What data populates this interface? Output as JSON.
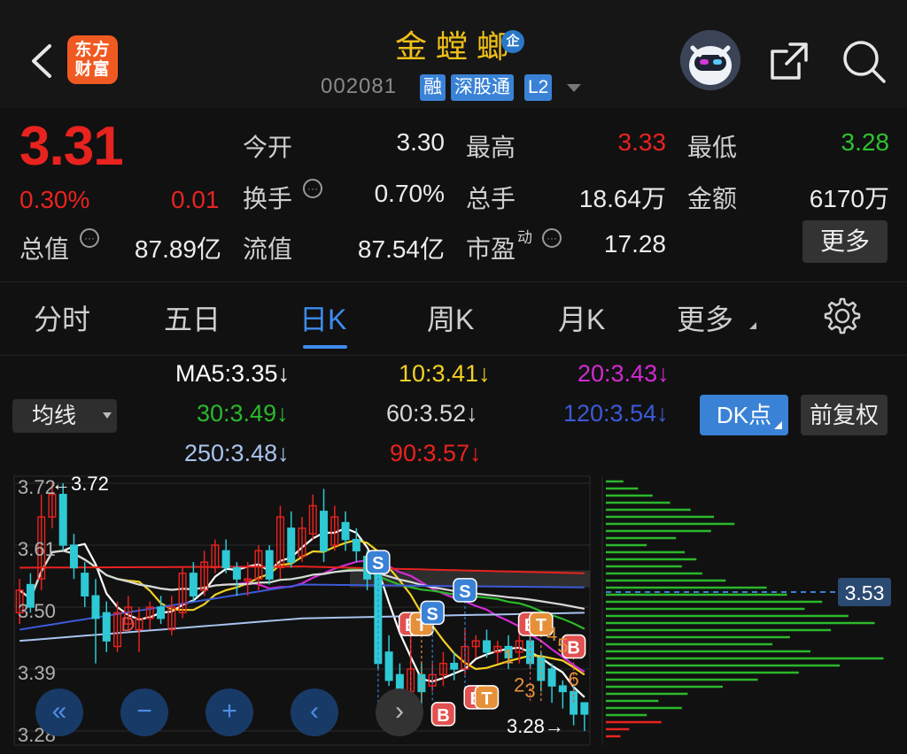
{
  "header": {
    "back_icon": "chevron-left-icon",
    "logo_line1": "东方",
    "logo_line2": "财富",
    "stock_name": "金螳螂",
    "badge": "企",
    "code": "002081",
    "tags": [
      "融",
      "深股通",
      "L2"
    ],
    "share_icon": "share-icon",
    "search_icon": "search-icon"
  },
  "quote": {
    "price": "3.31",
    "change_pct": "0.30%",
    "change": "0.01",
    "stats": [
      {
        "label": "今开",
        "value": "3.30",
        "color": "#ececec"
      },
      {
        "label": "最高",
        "value": "3.33",
        "color": "#e8231f"
      },
      {
        "label": "最低",
        "value": "3.28",
        "color": "#2fc22f"
      },
      {
        "label": "换手",
        "value": "0.70%",
        "color": "#ececec"
      },
      {
        "label": "总手",
        "value": "18.64万",
        "color": "#ececec"
      },
      {
        "label": "金额",
        "value": "6170万",
        "color": "#ececec"
      },
      {
        "label": "总值",
        "value": "87.89亿",
        "color": "#ececec"
      },
      {
        "label": "流值",
        "value": "87.54亿",
        "color": "#ececec"
      },
      {
        "label": "市盈",
        "label_sup": "动",
        "value": "17.28",
        "color": "#ececec"
      }
    ],
    "more_label": "更多"
  },
  "tabs": [
    "分时",
    "五日",
    "日K",
    "周K",
    "月K",
    "更多"
  ],
  "active_tab": "日K",
  "ma": {
    "select_label": "均线",
    "dk_label": "DK点",
    "fq_label": "前复权",
    "items": [
      {
        "text": "MA5:3.35↓",
        "color": "#ffffff"
      },
      {
        "text": "10:3.41↓",
        "color": "#f2d024"
      },
      {
        "text": "20:3.43↓",
        "color": "#d22ad2"
      },
      {
        "text": "30:3.49↓",
        "color": "#2bb82b"
      },
      {
        "text": "60:3.52↓",
        "color": "#d8d8d8"
      },
      {
        "text": "120:3.54↓",
        "color": "#3c5ad8"
      },
      {
        "text": "250:3.48↓",
        "color": "#a9c3ee"
      },
      {
        "text": "90:3.57↓",
        "color": "#e8231f"
      }
    ]
  },
  "chart_data": {
    "type": "candlestick",
    "y_ticks": [
      "3.72",
      "3.61",
      "3.50",
      "3.39",
      "3.28"
    ],
    "ylim": [
      3.28,
      3.72
    ],
    "max_label": "3.72",
    "min_label": "3.28",
    "volume_profile_label": "3.53",
    "colors": {
      "up": "#e8231f",
      "down": "#2ec9d4"
    },
    "candles": [
      {
        "o": 3.49,
        "c": 3.53,
        "h": 3.55,
        "l": 3.47
      },
      {
        "o": 3.54,
        "c": 3.5,
        "h": 3.56,
        "l": 3.49
      },
      {
        "o": 3.55,
        "c": 3.66,
        "h": 3.7,
        "l": 3.53
      },
      {
        "o": 3.66,
        "c": 3.7,
        "h": 3.72,
        "l": 3.64
      },
      {
        "o": 3.7,
        "c": 3.61,
        "h": 3.72,
        "l": 3.6
      },
      {
        "o": 3.61,
        "c": 3.57,
        "h": 3.63,
        "l": 3.55
      },
      {
        "o": 3.56,
        "c": 3.52,
        "h": 3.58,
        "l": 3.5
      },
      {
        "o": 3.52,
        "c": 3.48,
        "h": 3.55,
        "l": 3.4
      },
      {
        "o": 3.49,
        "c": 3.44,
        "h": 3.51,
        "l": 3.42
      },
      {
        "o": 3.43,
        "c": 3.49,
        "h": 3.51,
        "l": 3.42
      },
      {
        "o": 3.47,
        "c": 3.5,
        "h": 3.52,
        "l": 3.46
      },
      {
        "o": 3.46,
        "c": 3.48,
        "h": 3.5,
        "l": 3.42
      },
      {
        "o": 3.48,
        "c": 3.5,
        "h": 3.51,
        "l": 3.46
      },
      {
        "o": 3.5,
        "c": 3.48,
        "h": 3.52,
        "l": 3.47
      },
      {
        "o": 3.46,
        "c": 3.5,
        "h": 3.52,
        "l": 3.45
      },
      {
        "o": 3.49,
        "c": 3.56,
        "h": 3.57,
        "l": 3.48
      },
      {
        "o": 3.56,
        "c": 3.52,
        "h": 3.58,
        "l": 3.51
      },
      {
        "o": 3.53,
        "c": 3.58,
        "h": 3.6,
        "l": 3.52
      },
      {
        "o": 3.57,
        "c": 3.61,
        "h": 3.62,
        "l": 3.56
      },
      {
        "o": 3.6,
        "c": 3.57,
        "h": 3.62,
        "l": 3.56
      },
      {
        "o": 3.57,
        "c": 3.55,
        "h": 3.58,
        "l": 3.52
      },
      {
        "o": 3.55,
        "c": 3.55,
        "h": 3.58,
        "l": 3.52
      },
      {
        "o": 3.55,
        "c": 3.6,
        "h": 3.61,
        "l": 3.53
      },
      {
        "o": 3.6,
        "c": 3.55,
        "h": 3.61,
        "l": 3.54
      },
      {
        "o": 3.57,
        "c": 3.66,
        "h": 3.68,
        "l": 3.55
      },
      {
        "o": 3.64,
        "c": 3.58,
        "h": 3.67,
        "l": 3.57
      },
      {
        "o": 3.59,
        "c": 3.64,
        "h": 3.66,
        "l": 3.58
      },
      {
        "o": 3.63,
        "c": 3.68,
        "h": 3.7,
        "l": 3.62
      },
      {
        "o": 3.67,
        "c": 3.6,
        "h": 3.71,
        "l": 3.58
      },
      {
        "o": 3.61,
        "c": 3.66,
        "h": 3.68,
        "l": 3.6
      },
      {
        "o": 3.65,
        "c": 3.62,
        "h": 3.67,
        "l": 3.6
      },
      {
        "o": 3.62,
        "c": 3.6,
        "h": 3.64,
        "l": 3.58
      },
      {
        "o": 3.59,
        "c": 3.55,
        "h": 3.6,
        "l": 3.53
      },
      {
        "o": 3.56,
        "c": 3.4,
        "h": 3.57,
        "l": 3.39
      },
      {
        "o": 3.42,
        "c": 3.37,
        "h": 3.45,
        "l": 3.36
      },
      {
        "o": 3.38,
        "c": 3.35,
        "h": 3.4,
        "l": 3.34
      },
      {
        "o": 3.35,
        "c": 3.39,
        "h": 3.45,
        "l": 3.33
      },
      {
        "o": 3.38,
        "c": 3.35,
        "h": 3.4,
        "l": 3.32
      },
      {
        "o": 3.36,
        "c": 3.38,
        "h": 3.4,
        "l": 3.35
      },
      {
        "o": 3.38,
        "c": 3.4,
        "h": 3.42,
        "l": 3.36
      },
      {
        "o": 3.4,
        "c": 3.39,
        "h": 3.42,
        "l": 3.37
      },
      {
        "o": 3.39,
        "c": 3.43,
        "h": 3.46,
        "l": 3.38
      },
      {
        "o": 3.43,
        "c": 3.44,
        "h": 3.45,
        "l": 3.41
      },
      {
        "o": 3.44,
        "c": 3.42,
        "h": 3.46,
        "l": 3.41
      },
      {
        "o": 3.42,
        "c": 3.43,
        "h": 3.44,
        "l": 3.4
      },
      {
        "o": 3.43,
        "c": 3.41,
        "h": 3.45,
        "l": 3.39
      },
      {
        "o": 3.42,
        "c": 3.44,
        "h": 3.46,
        "l": 3.4
      },
      {
        "o": 3.44,
        "c": 3.4,
        "h": 3.45,
        "l": 3.39
      },
      {
        "o": 3.41,
        "c": 3.37,
        "h": 3.42,
        "l": 3.35
      },
      {
        "o": 3.39,
        "c": 3.36,
        "h": 3.4,
        "l": 3.33
      },
      {
        "o": 3.36,
        "c": 3.35,
        "h": 3.37,
        "l": 3.32
      },
      {
        "o": 3.35,
        "c": 3.31,
        "h": 3.36,
        "l": 3.29
      },
      {
        "o": 3.33,
        "c": 3.31,
        "h": 3.33,
        "l": 3.28
      }
    ],
    "signals": [
      {
        "i": 33,
        "price": 3.58,
        "text": "S",
        "kind": "blue"
      },
      {
        "i": 36,
        "price": 3.47,
        "text": "E",
        "kind": "red"
      },
      {
        "i": 37,
        "price": 3.47,
        "text": "T",
        "kind": "orange"
      },
      {
        "i": 38,
        "price": 3.49,
        "text": "S",
        "kind": "blue"
      },
      {
        "i": 39,
        "price": 3.31,
        "text": "B",
        "kind": "red"
      },
      {
        "i": 41,
        "price": 3.53,
        "text": "S",
        "kind": "blue"
      },
      {
        "i": 42,
        "price": 3.34,
        "text": "E",
        "kind": "red"
      },
      {
        "i": 43,
        "price": 3.34,
        "text": "T",
        "kind": "orange"
      },
      {
        "i": 47,
        "price": 3.47,
        "text": "E",
        "kind": "red"
      },
      {
        "i": 48,
        "price": 3.47,
        "text": "T",
        "kind": "orange"
      },
      {
        "i": 51,
        "price": 3.43,
        "text": "B",
        "kind": "red"
      }
    ],
    "count_labels": [
      {
        "i": 45,
        "price": 3.4,
        "text": "1"
      },
      {
        "i": 46,
        "price": 3.35,
        "text": "2"
      },
      {
        "i": 47,
        "price": 3.34,
        "text": "3"
      },
      {
        "i": 49,
        "price": 3.44,
        "text": "4"
      },
      {
        "i": 50,
        "price": 3.42,
        "text": "5"
      },
      {
        "i": 51,
        "price": 3.36,
        "text": "6"
      }
    ],
    "d_label": {
      "i": 9,
      "price": 3.47,
      "text": "D"
    },
    "volume_profile": [
      0.06,
      0.11,
      0.16,
      0.22,
      0.29,
      0.37,
      0.44,
      0.36,
      0.24,
      0.14,
      0.27,
      0.31,
      0.26,
      0.33,
      0.41,
      0.55,
      0.62,
      0.74,
      0.68,
      0.83,
      0.92,
      0.77,
      0.63,
      0.57,
      0.7,
      0.95,
      0.8,
      0.66,
      0.52,
      0.4,
      0.28,
      0.18,
      0.26,
      0.14,
      0.19,
      0.08,
      0.05
    ]
  },
  "chart_nav": [
    "fast-back-icon",
    "zoom-out-icon",
    "zoom-in-icon",
    "prev-icon",
    "next-icon"
  ]
}
